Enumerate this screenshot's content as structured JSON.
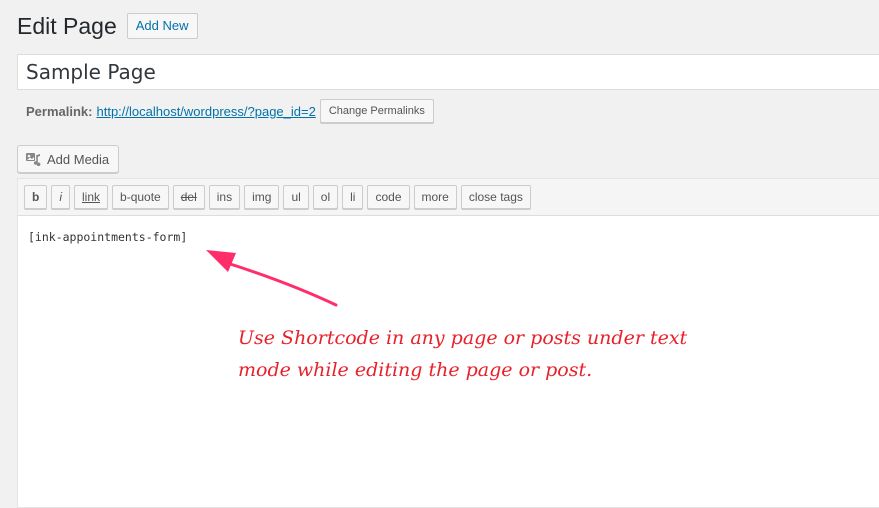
{
  "header": {
    "title": "Edit Page",
    "add_new_label": "Add New"
  },
  "post": {
    "title_value": "Sample Page"
  },
  "permalink": {
    "label": "Permalink:",
    "url": "http://localhost/wordpress/?page_id=2",
    "change_button_label": "Change Permalinks"
  },
  "media": {
    "add_media_label": "Add Media",
    "icon": "add-media-icon"
  },
  "quicktags": [
    {
      "label": "b",
      "name": "qt-bold-button"
    },
    {
      "label": "i",
      "name": "qt-italic-button"
    },
    {
      "label": "link",
      "name": "qt-link-button"
    },
    {
      "label": "b-quote",
      "name": "qt-blockquote-button"
    },
    {
      "label": "del",
      "name": "qt-del-button"
    },
    {
      "label": "ins",
      "name": "qt-ins-button"
    },
    {
      "label": "img",
      "name": "qt-img-button"
    },
    {
      "label": "ul",
      "name": "qt-ul-button"
    },
    {
      "label": "ol",
      "name": "qt-ol-button"
    },
    {
      "label": "li",
      "name": "qt-li-button"
    },
    {
      "label": "code",
      "name": "qt-code-button"
    },
    {
      "label": "more",
      "name": "qt-more-button"
    },
    {
      "label": "close tags",
      "name": "qt-close-tags-button"
    }
  ],
  "editor": {
    "content": "[ink-appointments-form]"
  },
  "annotation": {
    "line1": "Use Shortcode in any page or posts under text",
    "line2": "mode while editing the page or post.",
    "color": "#e8202a",
    "arrow_color": "#ff2e6b"
  }
}
